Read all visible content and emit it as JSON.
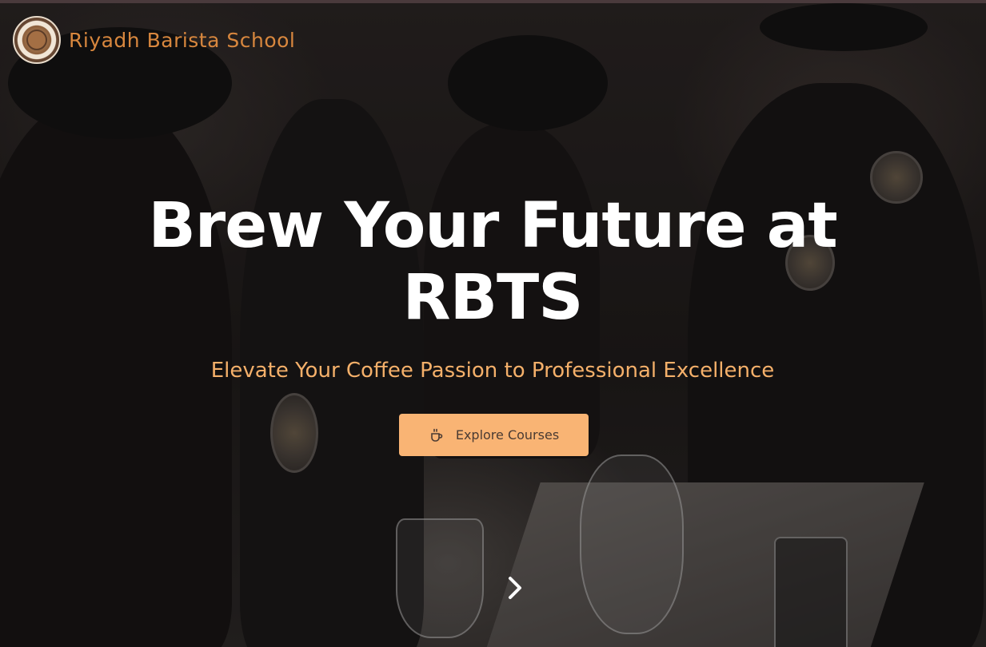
{
  "brand": {
    "name": "Riyadh Barista School",
    "logo_icon": "school-emblem-logo"
  },
  "hero": {
    "title": "Brew Your Future at RBTS",
    "subtitle": "Elevate Your Coffee Passion to Professional Excellence",
    "cta_label": "Explore Courses",
    "cta_icon": "coffee-cup-icon",
    "next_icon": "chevron-right-icon"
  },
  "colors": {
    "accent": "#f9b474",
    "brand_text": "#d8873e",
    "subtitle": "#f5b06a"
  }
}
